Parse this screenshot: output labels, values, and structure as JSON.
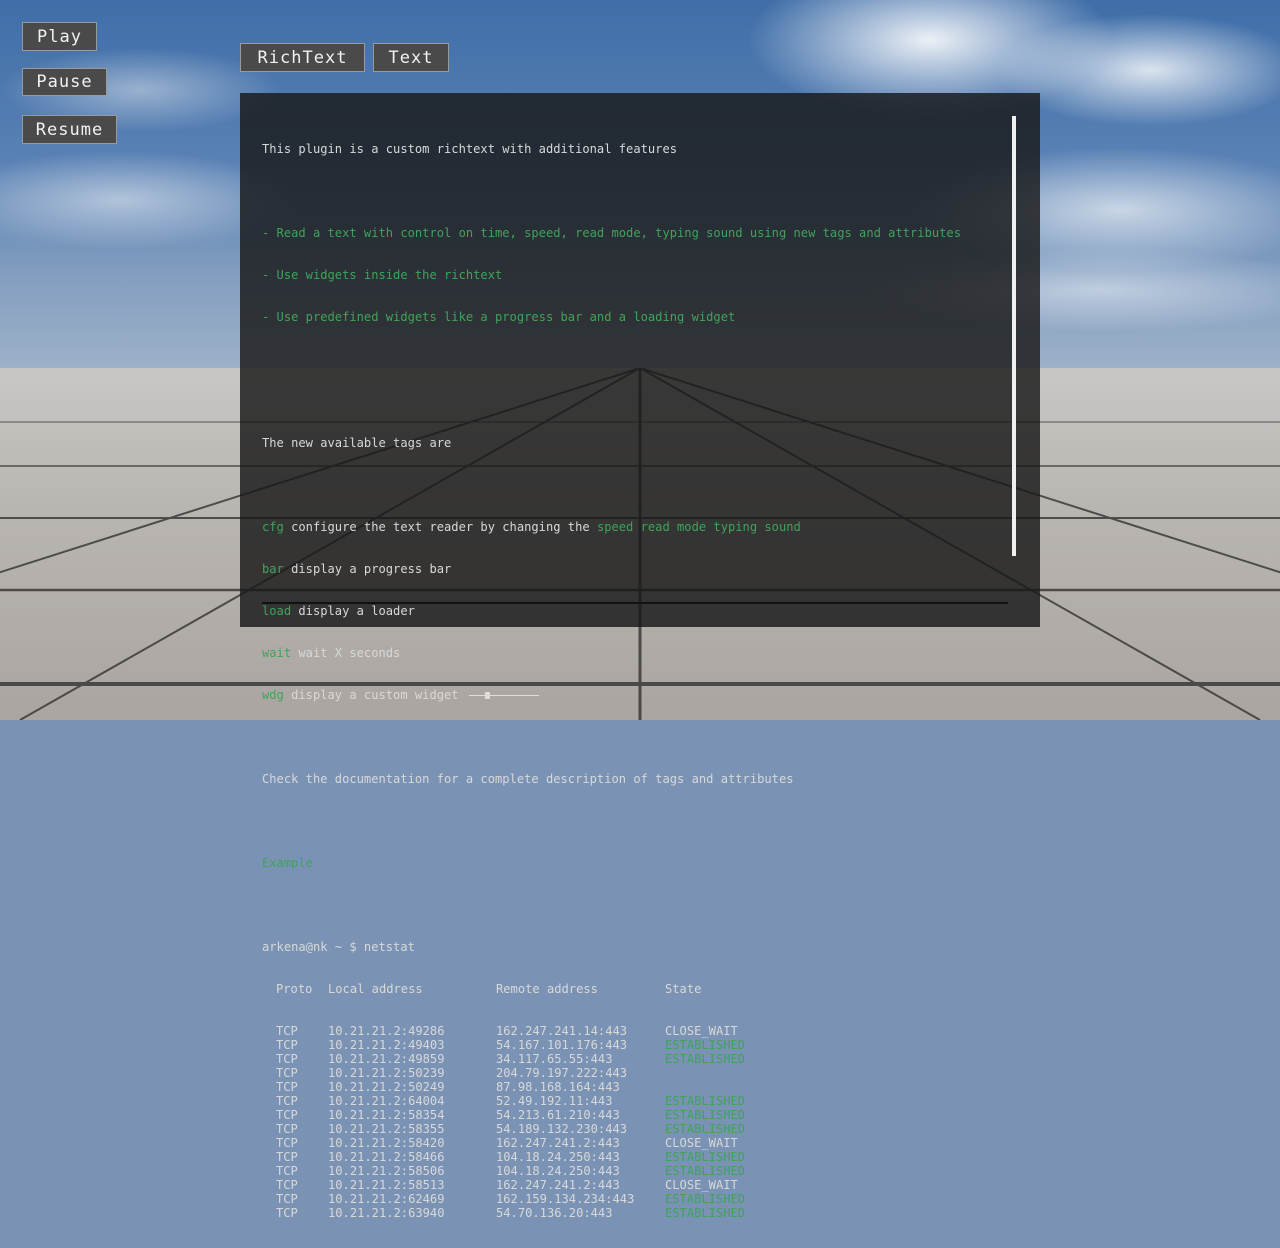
{
  "controls": {
    "play": "Play",
    "pause": "Pause",
    "resume": "Resume"
  },
  "tabs": {
    "richtext": "RichText",
    "text": "Text"
  },
  "panel": {
    "intro": "This plugin is a custom richtext with additional features",
    "features": [
      "- Read a text with control on time, speed, read mode, typing sound using new tags and attributes",
      "- Use widgets inside the richtext",
      "- Use predefined widgets like a progress bar and a loading widget"
    ],
    "tags_heading": "The new available tags are",
    "tags": [
      {
        "tag": "cfg",
        "desc": " configure the text reader by changing the ",
        "extra": "speed read mode typing sound"
      },
      {
        "tag": "bar",
        "desc": " display a progress bar",
        "extra": ""
      },
      {
        "tag": "load",
        "desc": " display a loader",
        "extra": ""
      },
      {
        "tag": "wait",
        "desc": " wait X seconds",
        "extra": ""
      },
      {
        "tag": "wdg",
        "desc": " display a custom widget",
        "extra": ""
      }
    ],
    "custom_widget_level": 0.25,
    "doc_note": "Check the documentation for a complete description of tags and attributes",
    "example_label": "Example",
    "prompt": "arkena@nk ~ $ netstat",
    "table_header": [
      "Proto",
      "Local address",
      "Remote address",
      "State"
    ],
    "rows": [
      [
        "TCP",
        "10.21.21.2:49286",
        "162.247.241.14:443",
        "CLOSE_WAIT"
      ],
      [
        "TCP",
        "10.21.21.2:49403",
        "54.167.101.176:443",
        "ESTABLISHED"
      ],
      [
        "TCP",
        "10.21.21.2:49859",
        "34.117.65.55:443",
        "ESTABLISHED"
      ],
      [
        "TCP",
        "10.21.21.2:50239",
        "204.79.197.222:443",
        ""
      ],
      [
        "TCP",
        "10.21.21.2:50249",
        "87.98.168.164:443",
        ""
      ],
      [
        "TCP",
        "10.21.21.2:64004",
        "52.49.192.11:443",
        "ESTABLISHED"
      ],
      [
        "TCP",
        "10.21.21.2:58354",
        "54.213.61.210:443",
        "ESTABLISHED"
      ],
      [
        "TCP",
        "10.21.21.2:58355",
        "54.189.132.230:443",
        "ESTABLISHED"
      ],
      [
        "TCP",
        "10.21.21.2:58420",
        "162.247.241.2:443",
        "CLOSE_WAIT"
      ],
      [
        "TCP",
        "10.21.21.2:58466",
        "104.18.24.250:443",
        "ESTABLISHED"
      ],
      [
        "TCP",
        "10.21.21.2:58506",
        "104.18.24.250:443",
        "ESTABLISHED"
      ],
      [
        "TCP",
        "10.21.21.2:58513",
        "162.247.241.2:443",
        "CLOSE_WAIT"
      ],
      [
        "TCP",
        "10.21.21.2:62469",
        "162.159.134.234:443",
        "ESTABLISHED"
      ],
      [
        "TCP",
        "10.21.21.2:63940",
        "54.70.136.20:443",
        "ESTABLISHED"
      ]
    ]
  },
  "colors": {
    "accent_green": "#3fa35a",
    "text": "#d8d8d8",
    "panel_bg": "#181818"
  }
}
